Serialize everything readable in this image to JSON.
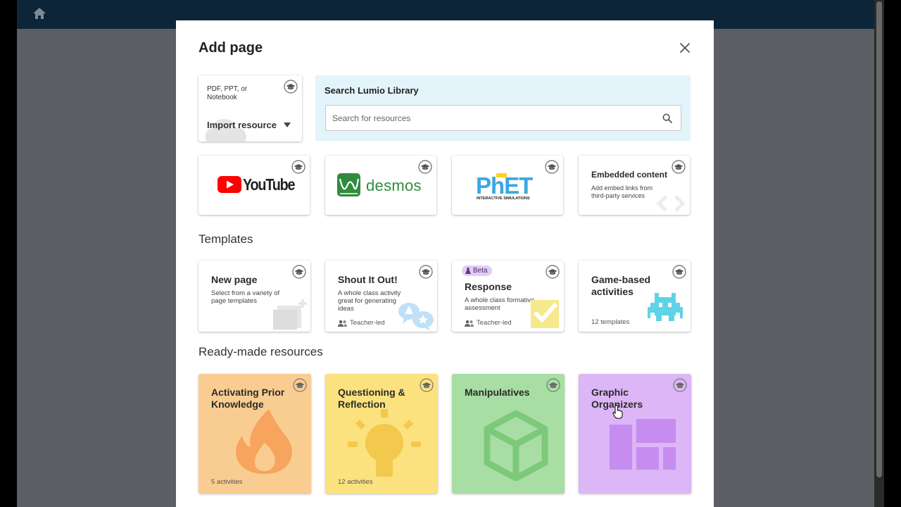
{
  "modal": {
    "title": "Add page",
    "import": {
      "description": "PDF, PPT, or Notebook",
      "label": "Import resource"
    },
    "search": {
      "title": "Search Lumio Library",
      "placeholder": "Search for resources"
    },
    "integrations": [
      {
        "name": "YouTube"
      },
      {
        "name": "desmos"
      },
      {
        "name": "PhET",
        "subtitle": "INTERACTIVE SIMULATIONS"
      },
      {
        "name": "Embedded content",
        "description": "Add embed links from third-party services"
      }
    ],
    "templates_heading": "Templates",
    "templates": [
      {
        "title": "New page",
        "description": "Select from a variety of page templates"
      },
      {
        "title": "Shout It Out!",
        "description": "A whole class activity great for generating ideas",
        "meta": "Teacher-led"
      },
      {
        "badge": "Beta",
        "title": "Response",
        "description": "A whole class formative assessment",
        "meta": "Teacher-led"
      },
      {
        "title": "Game-based activities",
        "meta": "12 templates"
      }
    ],
    "resources_heading": "Ready-made resources",
    "resources": [
      {
        "title": "Activating Prior Knowledge",
        "meta": "5 activities",
        "color": "#f9cd91"
      },
      {
        "title": "Questioning & Reflection",
        "meta": "12 activities",
        "color": "#fbe27e"
      },
      {
        "title": "Manipulatives",
        "meta": "",
        "color": "#a8dea4"
      },
      {
        "title": "Graphic Organizers",
        "meta": "",
        "color": "#dcb6f7"
      }
    ]
  },
  "colors": {
    "topbar": "#0d2538",
    "search_panel": "#e3f4fb",
    "youtube_red": "#ff0000",
    "desmos_green": "#2f8c3f",
    "phet_blue": "#3ba6e4",
    "phet_yellow": "#ffd21f"
  }
}
